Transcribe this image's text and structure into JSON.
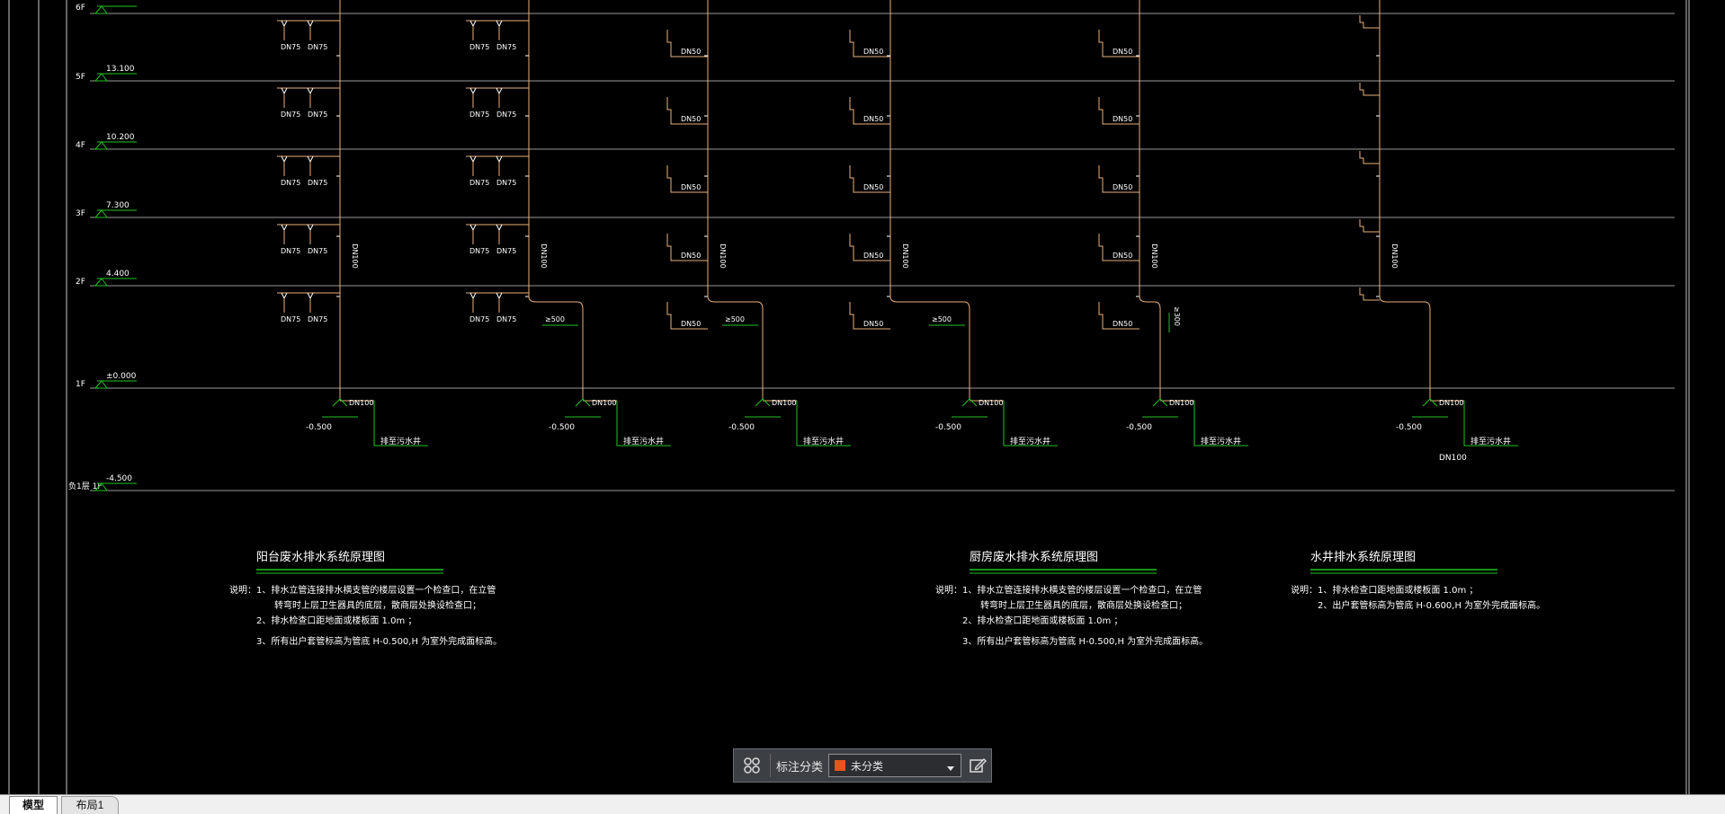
{
  "drawing": {
    "floors": [
      {
        "label": "6F",
        "elev": ""
      },
      {
        "label": "5F",
        "elev": "13.100"
      },
      {
        "label": "4F",
        "elev": "10.200"
      },
      {
        "label": "3F",
        "elev": "7.300"
      },
      {
        "label": "2F",
        "elev": "4.400"
      },
      {
        "label": "1F",
        "elev": "±0.000"
      },
      {
        "label": "负1层 1F",
        "elev": "-4.500"
      }
    ],
    "pipe_labels": {
      "dn75": "DN75",
      "dn50": "DN50",
      "dn100": "DN100",
      "gt500": "≥500",
      "gt300": "≥300",
      "bottom_elev": "-0.500",
      "manhole": "排至污水井"
    },
    "notes": [
      {
        "title": "阳台废水排水系统原理图",
        "prefix": "说明：",
        "lines": [
          "1、排水立管连接排水横支管的楼层设置一个检查口，在立管",
          "转弯时上层卫生器具的底层，散商层处换设检查口；",
          "2、排水检查口距地面或楼板面          1.0m      ；",
          "3、所有出户套管标高为管底          H-0.500,H        为室外完成面标高。"
        ]
      },
      {
        "title": "厨房废水排水系统原理图",
        "prefix": "说明：",
        "lines": [
          "1、排水立管连接排水横支管的楼层设置一个检查口，在立管",
          "转弯时上层卫生器具的底层，散商层处换设检查口；",
          "2、排水检查口距地面或楼板面          1.0m      ；",
          "3、所有出户套管标高为管底          H-0.500,H        为室外完成面标高。"
        ]
      },
      {
        "title": "水井排水系统原理图",
        "prefix": "说明：",
        "lines": [
          "1、排水检查口距地面或楼板面          1.0m      ；",
          "2、出户套管标高为管底       H-0.600,H        为室外完成面标高。"
        ]
      }
    ]
  },
  "toolbar": {
    "label": "标注分类",
    "selected": "未分类",
    "swatch_color": "#e8541c",
    "icons": {
      "grid": "grid-icon",
      "edit": "edit-icon",
      "chevron": "chevron-down-icon"
    }
  },
  "tabs": [
    {
      "label": "模型",
      "active": true
    },
    {
      "label": "布局1",
      "active": false
    }
  ],
  "colors": {
    "background": "#000000",
    "pipe": "#e8b07a",
    "floor_line": "#9a9a9a",
    "text": "#ffffff",
    "marker_green": "#22c322"
  }
}
